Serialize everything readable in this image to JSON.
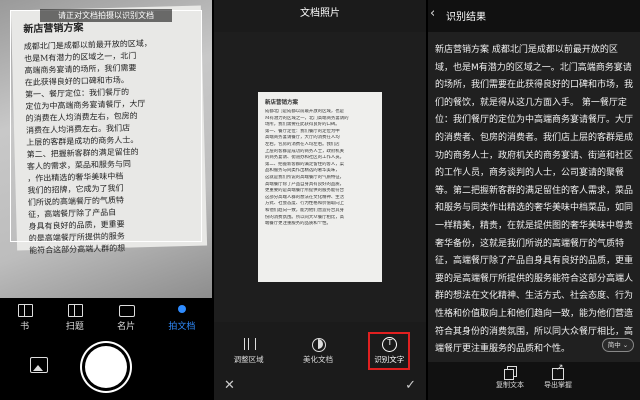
{
  "camera": {
    "detect_hint": "请正对文档拍摄以识别文档",
    "photo_title": "新店营销方案",
    "photo_lines": [
      "成都北门是成都以前最开放的区域，",
      "也是M有潜力的区域之一，北门",
      "高端商务宴请的场所，我们需要",
      "在此获得良好的口碑和市场。",
      "第一、餐厅定位：我们餐厅的",
      "定位为中高端商务宴请餐厅，大厅",
      "的消费在人均消费左右，包房的",
      "消费在人均消费左右。我们店",
      "上层的客群是成功的商务人士。",
      "第二、把握新客群的满足留住的",
      "客人的需求，菜品和服务与同",
      "，作出精选的奢华美味中档",
      "我们的招牌，它成为了我们",
      "们所说的高端餐厅的气质特",
      "征，高端餐厅除了产品自",
      "身具有良好的品质，更重要",
      "的是高端餐厅所提供的服务",
      "能符合这部分高端人群的想",
      "法在文化精神、生活方式、",
      "社会态度、行为性格和价值",
      "取向上和他们趋向一致，",
      "能为他们营造符合其身份的",
      "消费氛围。所以同大众餐厅",
      "相比，高端餐厅更注重服务的品质和个性。"
    ],
    "tabs": [
      {
        "label": "书"
      },
      {
        "label": "扫题"
      },
      {
        "label": "名片"
      },
      {
        "label": "拍文档"
      }
    ]
  },
  "doc": {
    "title": "文档照片",
    "page_title": "新店营销方案",
    "page_lines": [
      "成都北门是成都以前最开放的区域，也是",
      "M有潜力的区域之一，北门高端商务宴请的",
      "场所，我们需要在此获得良好的口碑。",
      "第一、餐厅定位：我们餐厅的定位为中",
      "高端商务宴请餐厅，大厅的消费在人均",
      "左右，包房的消费在人均左右。我们店",
      "上层的客群是成功的商务人士，政府机关",
      "的商务宴请、街道办和社区的工作人员。",
      "第二、把握新客群的满足留住的客人，菜",
      "品和服务与同类作出精选的奢华美味，",
      "这就是我们所说的高端餐厅的气质特征，",
      "高端餐厅除了产品自身具有良好的品质，",
      "更重要的是高端餐厅所提供的服务能符合",
      "这部分高端人群的想法在文化精神、生活",
      "方式、社会态度、行为性格和价值取向上",
      "和他们趋向一致，能为他们营造符合其身",
      "份的消费氛围。所以同大众餐厅相比，高",
      "端餐厅更注重服务的品质和个性。"
    ],
    "tools": [
      {
        "label": "调整区域"
      },
      {
        "label": "美化文档"
      },
      {
        "label": "识别文字"
      }
    ]
  },
  "result": {
    "title": "识别结果",
    "text": "新店营销方案    成都北门是成都以前最开放的区域，也是M有潜力的区域之一。北门高端商务宴请的场所，我们需要在此获得良好的口碑和市场，我们的餐饮，就是得从这几方面入手。    第一餐厅定位：我们餐厅的定位为中高端商务宴请餐厅。大厅的消费者、包房的消费者。我们店上层的客群是成功的商务人士，政府机关的商务宴请、街道和社区的工作人员，商务谈判的人士，公司宴请的聚餐等。第二把握新客群的满足留住的客人需求，菜品和服务与同类作出精选的奢华美味中档菜品，如同一样精美，精贵，在就是提供图的奢华美味中尊贵奢华备份，这就是我们所说的高端餐厅的气质特征，高端餐厅除了产品自身具有良好的品质，更重要的是高端餐厅所提供的服务能符合这部分高端人群的想法在文化精神、生活方式、社会态度、行为性格和价值取向上和他们趋向一致，能为他们营造符合其身份的消费氛围，所以同大众餐厅相比，高端餐厅更注重服务的品质和个性。",
    "lang": "简中 ⌄",
    "tools": [
      {
        "label": "复制文本"
      },
      {
        "label": "导出掌握"
      }
    ]
  }
}
